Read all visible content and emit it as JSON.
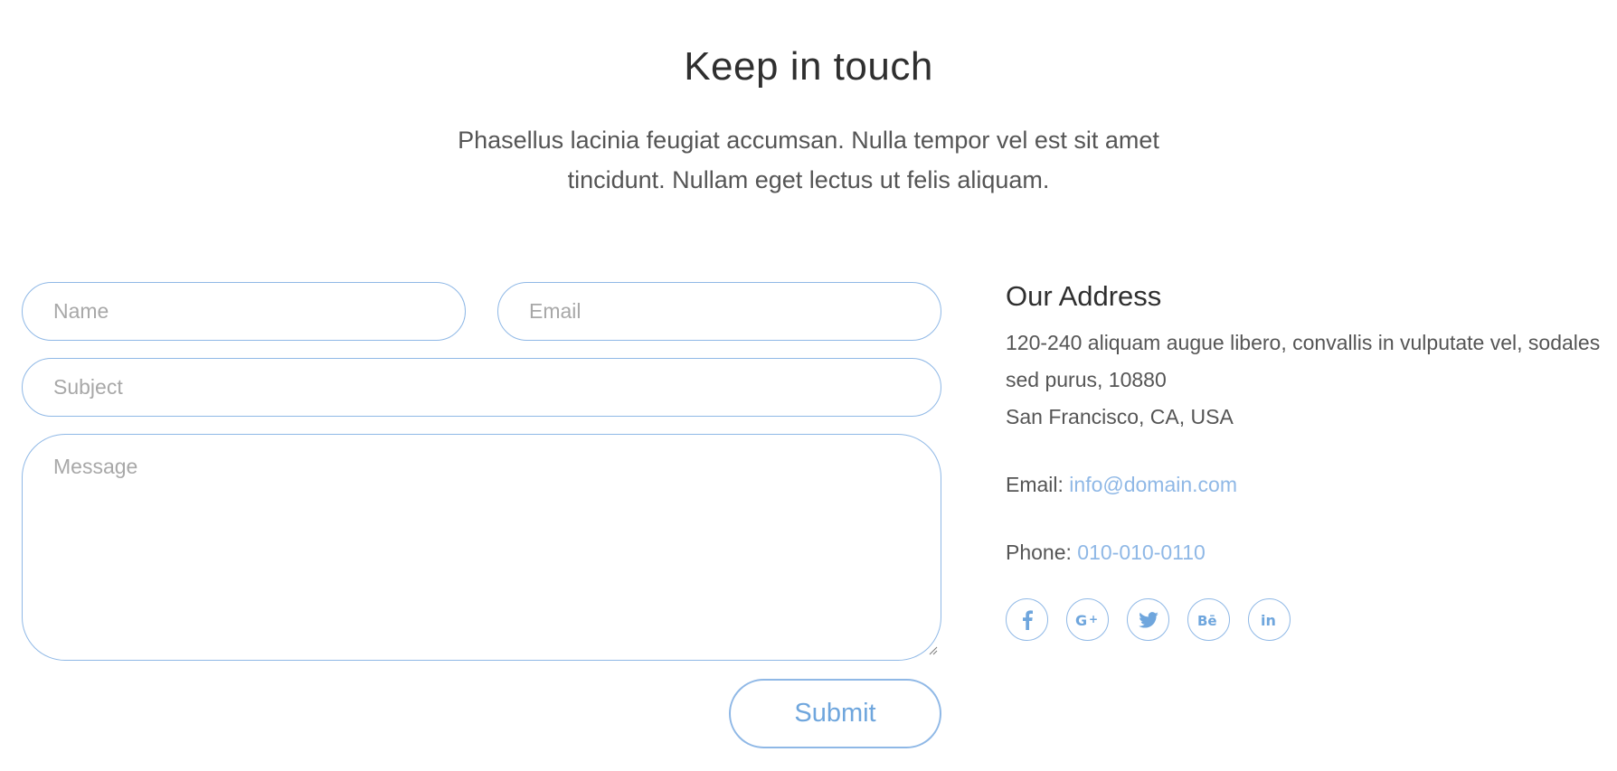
{
  "header": {
    "title": "Keep in touch",
    "intro_line1": "Phasellus lacinia feugiat accumsan. Nulla tempor vel est sit amet",
    "intro_line2": "tincidunt. Nullam eget lectus ut felis aliquam."
  },
  "form": {
    "name_placeholder": "Name",
    "email_placeholder": "Email",
    "subject_placeholder": "Subject",
    "message_placeholder": "Message",
    "submit_label": "Submit"
  },
  "address": {
    "title": "Our Address",
    "line1": "120-240 aliquam augue libero, convallis in vulputate vel, sodales",
    "line2": "sed purus, 10880",
    "line3": "San Francisco, CA, USA",
    "email_label": "Email:",
    "email_value": "info@domain.com",
    "phone_label": "Phone:",
    "phone_value": "010-010-0110"
  },
  "social": [
    {
      "icon": "facebook-icon",
      "glyph": "f"
    },
    {
      "icon": "google-plus-icon",
      "glyph": "G+"
    },
    {
      "icon": "twitter-icon",
      "glyph": "bird"
    },
    {
      "icon": "behance-icon",
      "glyph": "Bē"
    },
    {
      "icon": "linkedin-icon",
      "glyph": "in"
    }
  ],
  "colors": {
    "accent": "#8fb8e6",
    "link": "#6fa6dd",
    "text": "#555555",
    "heading": "#2f2f2f"
  }
}
